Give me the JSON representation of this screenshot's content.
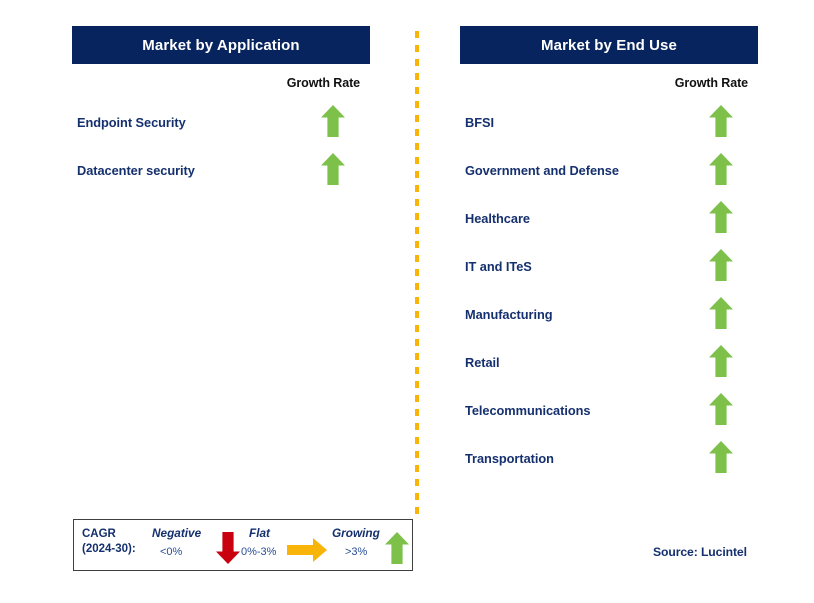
{
  "accent_colors": {
    "header_navy": "#08245e",
    "label_navy": "#15306e",
    "growth_green": "#7dc04a",
    "negative_red": "#c8000f",
    "flat_orange": "#f9b40a",
    "divider_orange": "#f9b40a"
  },
  "panels": [
    {
      "title": "Market by Application",
      "growth_rate_header": "Growth Rate",
      "rows": [
        {
          "label": "Endpoint Security",
          "growth": "growing",
          "icon": "arrow-up-icon"
        },
        {
          "label": "Datacenter security",
          "growth": "growing",
          "icon": "arrow-up-icon"
        }
      ]
    },
    {
      "title": "Market by End Use",
      "growth_rate_header": "Growth Rate",
      "rows": [
        {
          "label": "BFSI",
          "growth": "growing",
          "icon": "arrow-up-icon"
        },
        {
          "label": "Government and Defense",
          "growth": "growing",
          "icon": "arrow-up-icon"
        },
        {
          "label": "Healthcare",
          "growth": "growing",
          "icon": "arrow-up-icon"
        },
        {
          "label": "IT and ITeS",
          "growth": "growing",
          "icon": "arrow-up-icon"
        },
        {
          "label": "Manufacturing",
          "growth": "growing",
          "icon": "arrow-up-icon"
        },
        {
          "label": "Retail",
          "growth": "growing",
          "icon": "arrow-up-icon"
        },
        {
          "label": "Telecommunications",
          "growth": "growing",
          "icon": "arrow-up-icon"
        },
        {
          "label": "Transportation",
          "growth": "growing",
          "icon": "arrow-up-icon"
        }
      ]
    }
  ],
  "legend": {
    "title_line1": "CAGR",
    "title_line2": "(2024-30):",
    "items": [
      {
        "name": "Negative",
        "value": "<0%",
        "icon": "arrow-down-icon",
        "color": "#c8000f"
      },
      {
        "name": "Flat",
        "value": "0%-3%",
        "icon": "arrow-right-icon",
        "color": "#f9b40a"
      },
      {
        "name": "Growing",
        "value": ">3%",
        "icon": "arrow-up-icon",
        "color": "#7dc04a"
      }
    ]
  },
  "source": "Source: Lucintel"
}
